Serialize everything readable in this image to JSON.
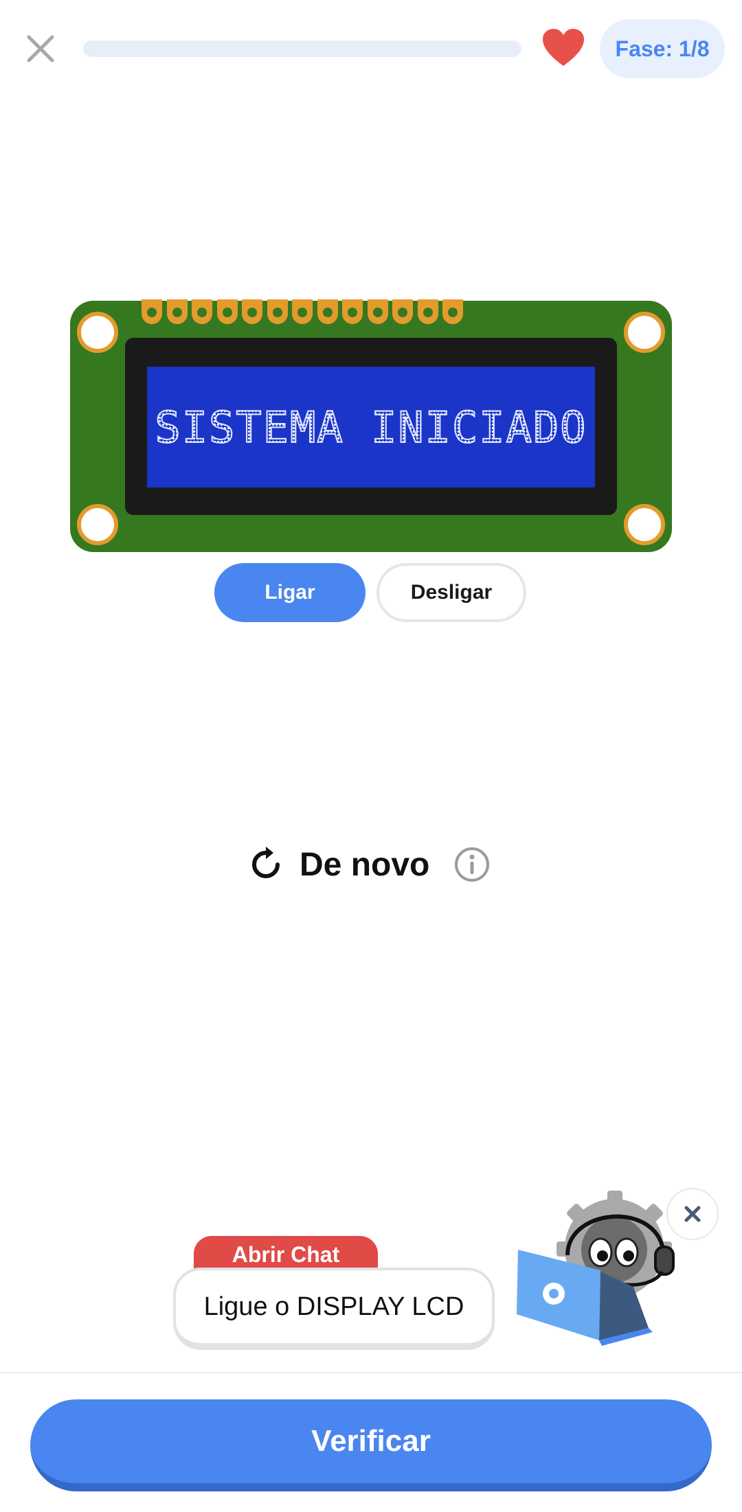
{
  "header": {
    "close_icon": "close-icon",
    "progress": 0.0,
    "lives_icon": "heart-icon",
    "phase_label": "Fase: 1/8"
  },
  "lcd": {
    "display_text": "SISTEMA INICIADO",
    "pin_count": 13
  },
  "controls": {
    "on_label": "Ligar",
    "off_label": "Desligar"
  },
  "retry": {
    "icon": "refresh-icon",
    "label": "De novo",
    "info_icon": "info-icon"
  },
  "chat": {
    "tag_label": "Abrir Chat",
    "message": "Ligue o DISPLAY LCD",
    "mascot": "robot-mascot",
    "close_icon": "close-icon"
  },
  "footer": {
    "verify_label": "Verificar"
  },
  "colors": {
    "accent": "#4a86f0",
    "heart": "#e8504a",
    "board": "#36781f",
    "screen": "#1a35c8",
    "chat_tag": "#e04a47"
  }
}
